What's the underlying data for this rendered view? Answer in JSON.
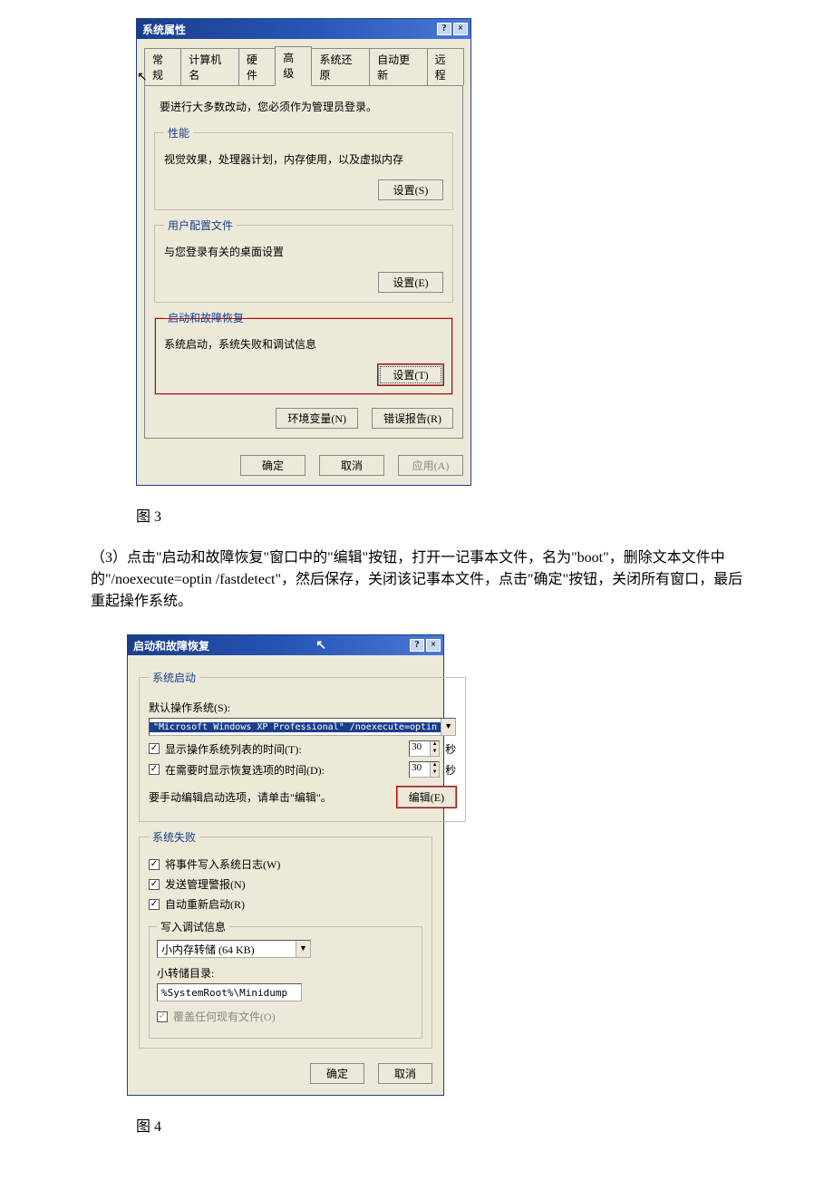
{
  "dialog1": {
    "title": "系统属性",
    "help_icon": "?",
    "close_icon": "×",
    "tabs": [
      "常规",
      "计算机名",
      "硬件",
      "高级",
      "系统还原",
      "自动更新",
      "远程"
    ],
    "active_tab": "高级",
    "note": "要进行大多数改动，您必须作为管理员登录。",
    "group_perf": {
      "legend": "性能",
      "desc": "视觉效果，处理器计划，内存使用，以及虚拟内存",
      "btn": "设置(S)"
    },
    "group_user": {
      "legend": "用户配置文件",
      "desc": "与您登录有关的桌面设置",
      "btn": "设置(E)"
    },
    "group_start": {
      "legend": "启动和故障恢复",
      "desc": "系统启动，系统失败和调试信息",
      "btn": "设置(T)"
    },
    "btn_env": "环境变量(N)",
    "btn_err": "错误报告(R)",
    "btn_ok": "确定",
    "btn_cancel": "取消",
    "btn_apply": "应用(A)"
  },
  "caption1": "图 3",
  "paragraph": "（3）点击\"启动和故障恢复\"窗口中的\"编辑\"按钮，打开一记事本文件，名为\"boot\"，删除文本文件中的\"/noexecute=optin /fastdetect\"，然后保存，关闭该记事本文件，点击\"确定\"按钮，关闭所有窗口，最后重起操作系统。",
  "dialog2": {
    "title": "启动和故障恢复",
    "help_icon": "?",
    "close_icon": "×",
    "grp_start": {
      "legend": "系统启动",
      "default_os_label": "默认操作系统(S):",
      "default_os_value": "\"Microsoft Windows XP Professional\" /noexecute=optin",
      "cb_showlist": "显示操作系统列表的时间(T):",
      "cb_showrecover": "在需要时显示恢复选项的时间(D):",
      "val_showlist": "30",
      "val_showrecover": "30",
      "seconds": "秒",
      "edit_hint": "要手动编辑启动选项，请单击\"编辑\"。",
      "btn_edit": "编辑(E)"
    },
    "grp_fail": {
      "legend": "系统失败",
      "cb_log": "将事件写入系统日志(W)",
      "cb_alert": "发送管理警报(N)",
      "cb_reboot": "自动重新启动(R)",
      "grp_dump": {
        "legend": "写入调试信息",
        "dump_type": "小内存转储 (64 KB)",
        "dir_label": "小转储目录:",
        "dir_value": "%SystemRoot%\\Minidump",
        "cb_overwrite": "覆盖任何现有文件(O)"
      }
    },
    "btn_ok": "确定",
    "btn_cancel": "取消"
  },
  "caption2": "图 4"
}
